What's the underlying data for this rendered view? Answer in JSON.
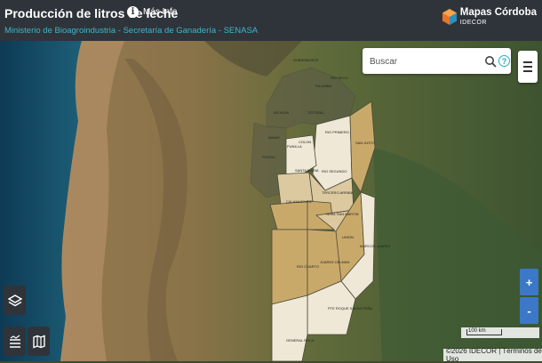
{
  "header": {
    "title": "Producción de litros de leche",
    "info_label": "Más Info",
    "subtitle": "Ministerio de Bioagroindustria - Secretaría de Ganadería - SENASA",
    "logo_main": "Mapas Córdoba",
    "logo_sub": "IDECOR"
  },
  "search": {
    "placeholder": "Buscar"
  },
  "map": {
    "departments": [
      "SOBREMONTE",
      "RIO SECO",
      "TULUMBA",
      "TOTORAL",
      "ISCHILIN",
      "MINAS",
      "POCHO",
      "RIO PRIMERO",
      "SAN JUSTO",
      "COLON",
      "PUNILLA",
      "SANTA MARIA",
      "RIO SEGUNDO",
      "CALAMUCHITA",
      "TERCERO ARRIBA",
      "GRAL SAN MARTIN",
      "UNION",
      "MARCOS JUAREZ",
      "RIO CUARTO",
      "JUAREZ CELMAN",
      "PTE ROQUE SAENZ PEÑA",
      "GENERAL ROCA"
    ],
    "scale_label": "100 km",
    "attribution": "©2026 IDECOR | Términos de Uso"
  },
  "controls": {
    "zoom_in": "+",
    "zoom_out": "-"
  },
  "colors": {
    "header_bg": "#2f343a",
    "accent": "#3fb6c8",
    "zoom": "#3c78c8",
    "high": "#c9a96a",
    "medium": "#dcc9a0",
    "low": "#f3eee2"
  }
}
